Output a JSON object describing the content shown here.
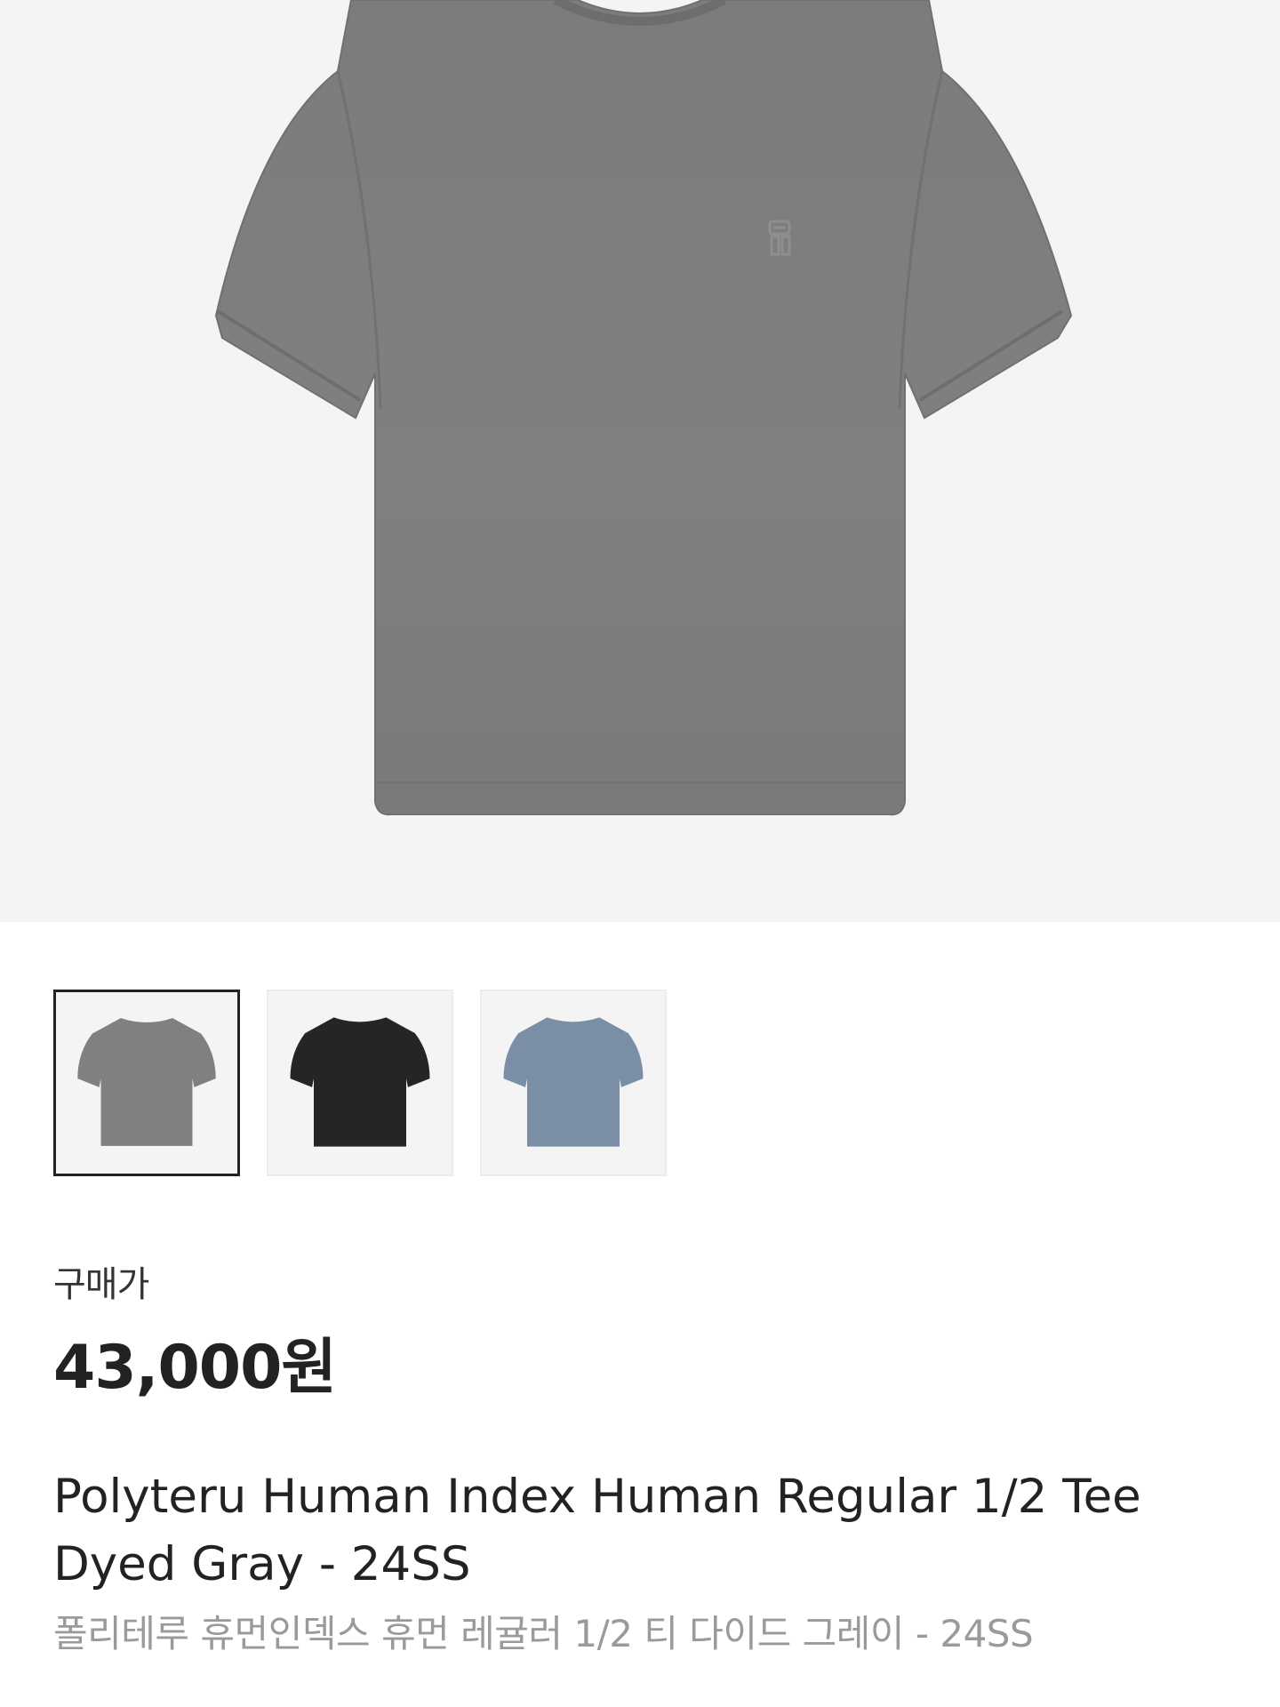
{
  "gallery": {
    "main_alt": "Polyteru Human Index Human Regular 1/2 Tee Dyed Gray",
    "thumbnails": [
      {
        "color_name": "dyed-gray",
        "color": "#7f807f",
        "selected": true
      },
      {
        "color_name": "black",
        "color": "#242526",
        "selected": false
      },
      {
        "color_name": "blue-gray",
        "color": "#7a8ea5",
        "selected": false
      }
    ]
  },
  "price": {
    "label": "구매가",
    "value": "43,000원"
  },
  "product": {
    "name_en": "Polyteru Human Index Human Regular 1/2 Tee Dyed Gray - 24SS",
    "name_ko": "폴리테루 휴먼인덱스 휴먼 레귤러 1/2 티 다이드 그레이 - 24SS"
  },
  "colors": {
    "hero_bg": "#f4f4f4",
    "tee_main": "#7d7e7d",
    "tee_shadow": "#6e6f6e",
    "text_primary": "#222222",
    "text_secondary": "#9a9a9a"
  }
}
